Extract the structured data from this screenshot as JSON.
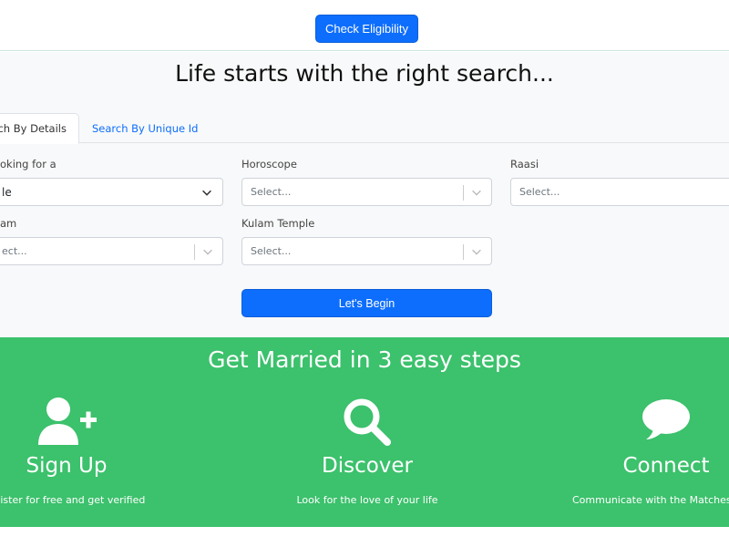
{
  "header": {
    "check_eligibility_label": "Check Eligibility"
  },
  "search": {
    "headline": "Life starts with the right search...",
    "tabs": [
      {
        "label": "rch By Details",
        "active": true
      },
      {
        "label": "Search By Unique Id",
        "active": false
      }
    ],
    "fields": {
      "looking_for": {
        "label": "oking for a",
        "value": "le"
      },
      "horoscope": {
        "label": "Horoscope",
        "placeholder": "Select..."
      },
      "raasi": {
        "label": "Raasi",
        "placeholder": "Select..."
      },
      "kulam": {
        "label": "am",
        "placeholder": "ect..."
      },
      "kulam_temple": {
        "label": "Kulam Temple",
        "placeholder": "Select..."
      }
    },
    "submit_label": "Let's Begin"
  },
  "steps": {
    "title": "Get Married in 3 easy steps",
    "items": [
      {
        "icon": "add-user-icon",
        "title": "Sign Up",
        "description": "egister for free and get verified"
      },
      {
        "icon": "search-icon",
        "title": "Discover",
        "description": "Look for the love of your life"
      },
      {
        "icon": "chat-bubble-icon",
        "title": "Connect",
        "description": "Communicate with the Matches y"
      }
    ]
  },
  "colors": {
    "primary": "#0d6efd",
    "steps_bg": "#3cc16c",
    "search_bg": "#f8f9fa"
  }
}
